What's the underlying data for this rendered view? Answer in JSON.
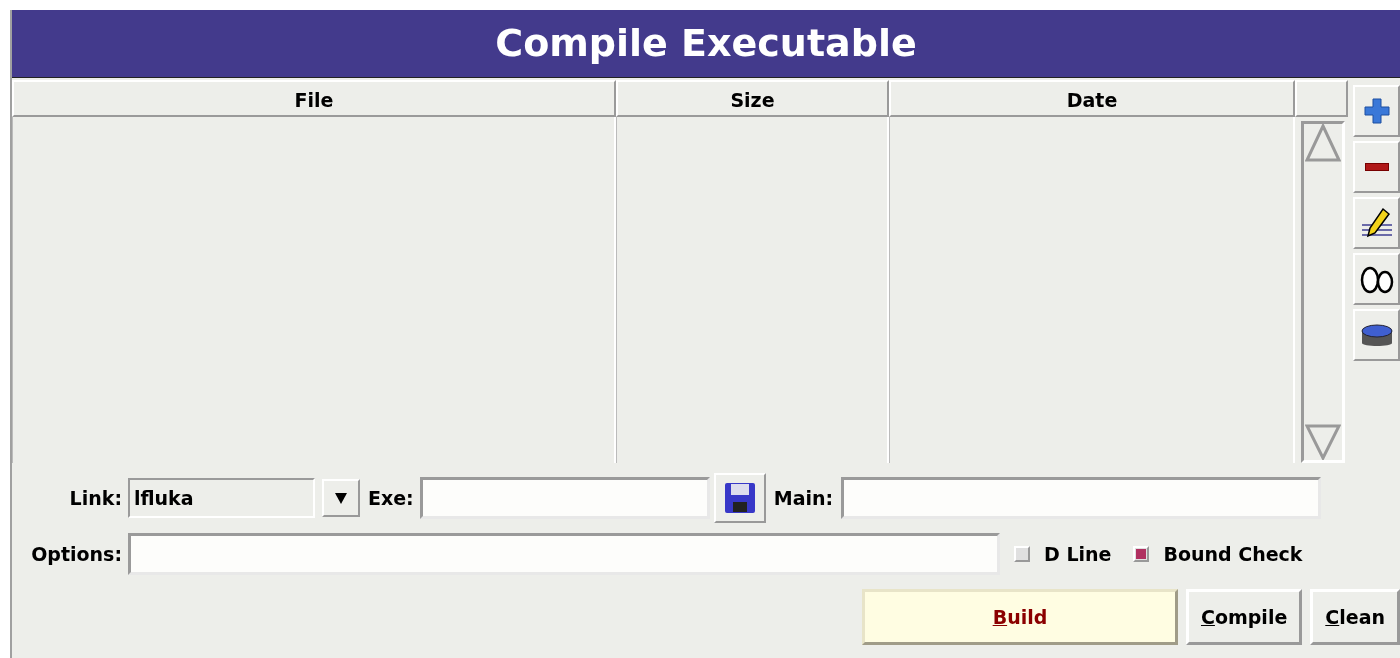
{
  "window": {
    "title": "Compile Executable"
  },
  "table": {
    "columns": [
      "File",
      "Size",
      "Date"
    ]
  },
  "link": {
    "label": "Link:",
    "value": "lfluka"
  },
  "exe": {
    "label": "Exe:"
  },
  "main": {
    "label": "Main:"
  },
  "options": {
    "label": "Options:"
  },
  "checkboxes": [
    {
      "label": "D Line",
      "checked": false
    },
    {
      "label": "Bound Check",
      "checked": true
    }
  ],
  "buttons": [
    {
      "label": "Build",
      "default": true
    },
    {
      "label": "Compile",
      "default": false
    },
    {
      "label": "Clean",
      "default": false
    }
  ]
}
